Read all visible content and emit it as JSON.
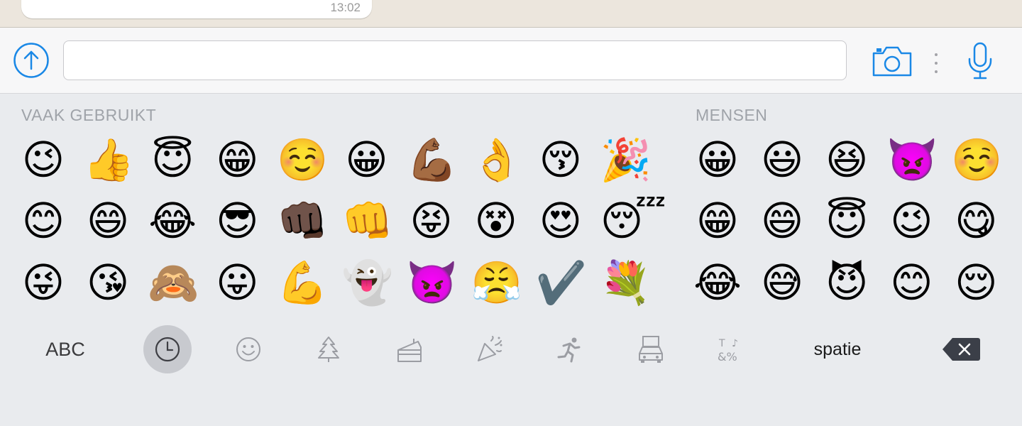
{
  "chat": {
    "message_time": "13:02"
  },
  "input_bar": {
    "attach_icon": "arrow-up-circle-icon",
    "placeholder": "",
    "camera_icon": "camera-icon",
    "more_icon": "vertical-dots-icon",
    "mic_icon": "microphone-icon",
    "accent_color": "#1a88e6"
  },
  "keyboard": {
    "sections": [
      {
        "title": "VAAK GEBRUIKT",
        "rows": [
          [
            "😉",
            "👍",
            "😇",
            "😁",
            "☺️",
            "😀",
            "💪🏾",
            "👌",
            "😚",
            "🎉"
          ],
          [
            "😊",
            "😄",
            "😂",
            "😎",
            "👊🏿",
            "👊",
            "😝",
            "😵",
            "😍",
            "😴"
          ],
          [
            "😜",
            "😘",
            "🙈",
            "😛",
            "💪",
            "👻",
            "👿",
            "😤",
            "✔️",
            "💐"
          ]
        ]
      },
      {
        "title": "MENSEN",
        "rows": [
          [
            "😀",
            "😃",
            "😆",
            "👿",
            "☺️"
          ],
          [
            "😁",
            "😄",
            "😇",
            "😉",
            "😋"
          ],
          [
            "😂",
            "😅",
            "😈",
            "😊",
            "😌"
          ]
        ]
      }
    ],
    "toolbar": {
      "abc_label": "ABC",
      "space_label": "spatie",
      "tabs": [
        {
          "name": "recent",
          "icon": "clock-icon",
          "selected": true
        },
        {
          "name": "people",
          "icon": "smiley-icon",
          "selected": false
        },
        {
          "name": "nature",
          "icon": "tree-icon",
          "selected": false
        },
        {
          "name": "food",
          "icon": "cake-icon",
          "selected": false
        },
        {
          "name": "celebration",
          "icon": "party-popper-icon",
          "selected": false
        },
        {
          "name": "activity",
          "icon": "running-person-icon",
          "selected": false
        },
        {
          "name": "places",
          "icon": "car-building-icon",
          "selected": false
        },
        {
          "name": "symbols",
          "icon": "symbols-icon",
          "selected": false
        }
      ],
      "delete_icon": "backspace-icon"
    }
  }
}
